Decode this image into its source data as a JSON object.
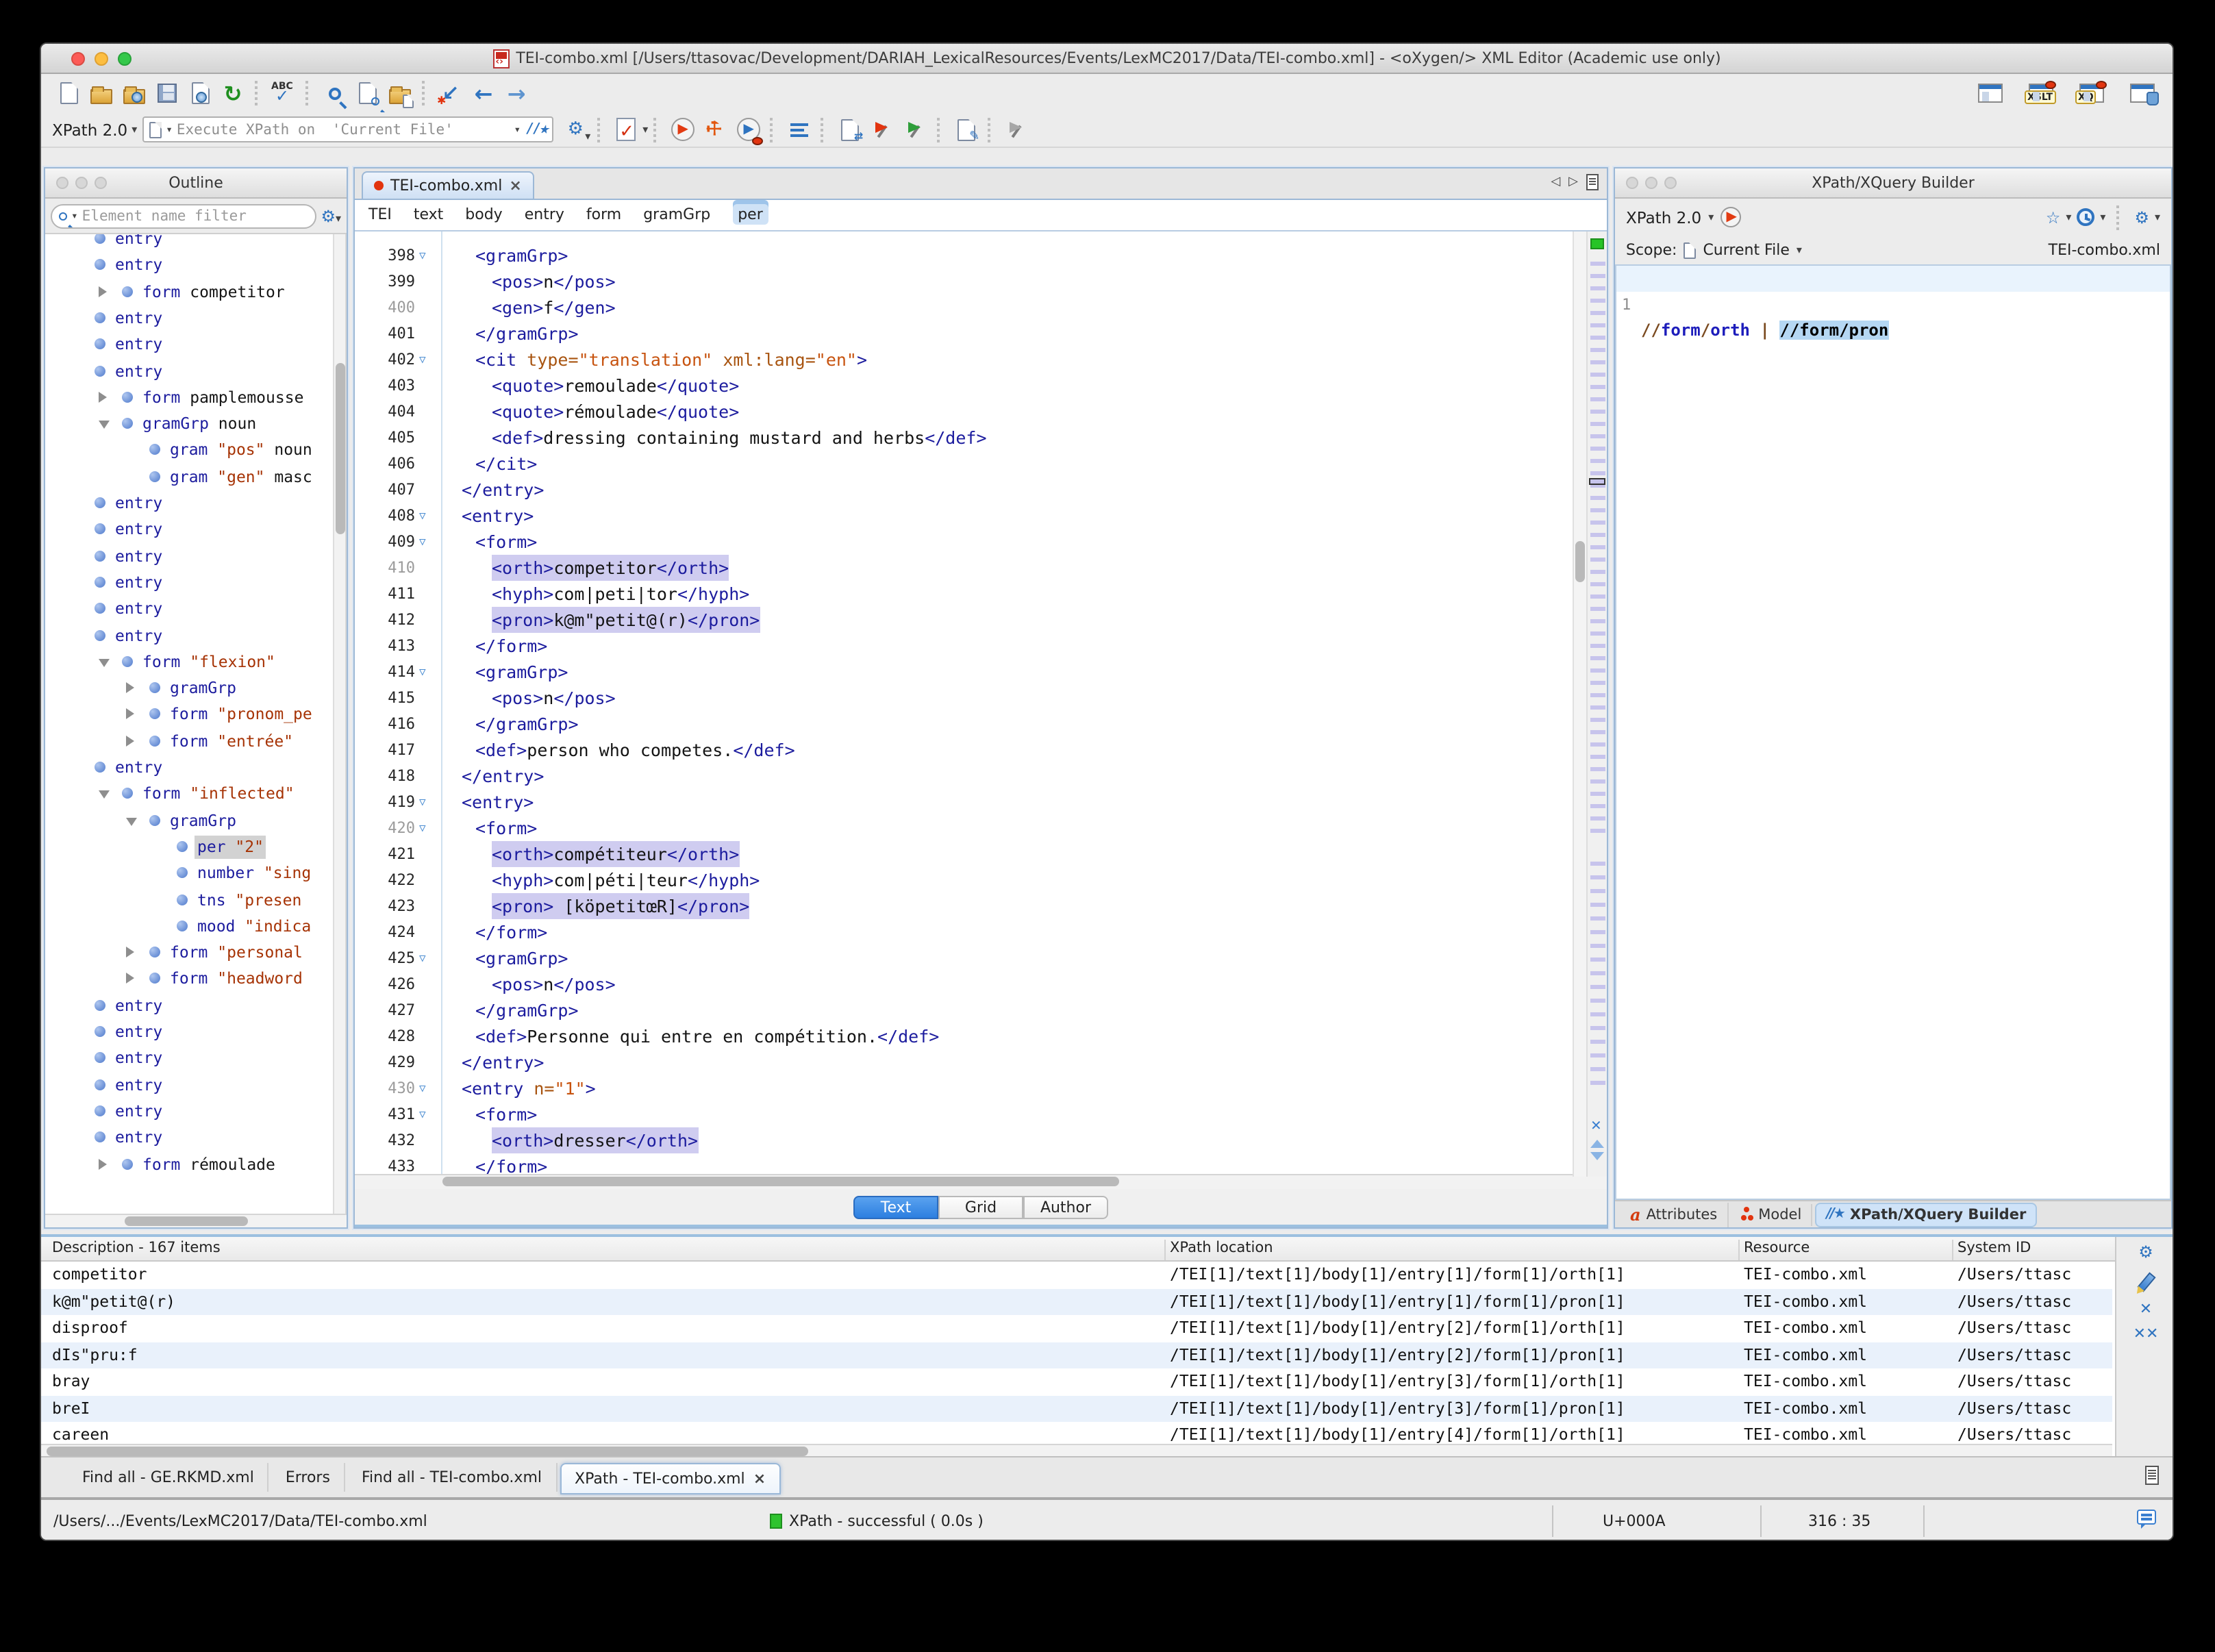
{
  "window": {
    "title": "TEI-combo.xml [/Users/ttasovac/Development/DARIAH_LexicalResources/Events/LexMC2017/Data/TEI-combo.xml] - <oXygen/> XML Editor (Academic use only)"
  },
  "toolbar": {
    "xpath_version": "XPath 2.0",
    "execute_label": "Execute XPath on",
    "execute_scope": "'Current File'"
  },
  "outline": {
    "title": "Outline",
    "filter_placeholder": "Element name filter",
    "items": [
      {
        "ind": 0,
        "arrow": "",
        "parts": [
          [
            "el",
            "entry"
          ]
        ],
        "clip": true
      },
      {
        "ind": 0,
        "arrow": "",
        "parts": [
          [
            "el",
            "entry"
          ]
        ]
      },
      {
        "ind": 1,
        "arrow": "r",
        "parts": [
          [
            "el",
            "form"
          ],
          [
            "tx",
            " competitor"
          ]
        ]
      },
      {
        "ind": 0,
        "arrow": "",
        "parts": [
          [
            "el",
            "entry"
          ]
        ]
      },
      {
        "ind": 0,
        "arrow": "",
        "parts": [
          [
            "el",
            "entry"
          ]
        ]
      },
      {
        "ind": 0,
        "arrow": "",
        "parts": [
          [
            "el",
            "entry"
          ]
        ]
      },
      {
        "ind": 1,
        "arrow": "r",
        "parts": [
          [
            "el",
            "form"
          ],
          [
            "tx",
            " pamplemousse"
          ]
        ]
      },
      {
        "ind": 1,
        "arrow": "d",
        "parts": [
          [
            "el",
            "gramGrp"
          ],
          [
            "tx",
            " noun"
          ]
        ]
      },
      {
        "ind": 2,
        "arrow": "",
        "parts": [
          [
            "el",
            "gram"
          ],
          [
            "q",
            " \"pos\""
          ],
          [
            "tx",
            " noun"
          ]
        ]
      },
      {
        "ind": 2,
        "arrow": "",
        "parts": [
          [
            "el",
            "gram"
          ],
          [
            "q",
            " \"gen\""
          ],
          [
            "tx",
            " masc"
          ]
        ]
      },
      {
        "ind": 0,
        "arrow": "",
        "parts": [
          [
            "el",
            "entry"
          ]
        ]
      },
      {
        "ind": 0,
        "arrow": "",
        "parts": [
          [
            "el",
            "entry"
          ]
        ]
      },
      {
        "ind": 0,
        "arrow": "",
        "parts": [
          [
            "el",
            "entry"
          ]
        ]
      },
      {
        "ind": 0,
        "arrow": "",
        "parts": [
          [
            "el",
            "entry"
          ]
        ]
      },
      {
        "ind": 0,
        "arrow": "",
        "parts": [
          [
            "el",
            "entry"
          ]
        ]
      },
      {
        "ind": 0,
        "arrow": "",
        "parts": [
          [
            "el",
            "entry"
          ]
        ]
      },
      {
        "ind": 1,
        "arrow": "d",
        "parts": [
          [
            "el",
            "form"
          ],
          [
            "q",
            " \"flexion\""
          ]
        ]
      },
      {
        "ind": 2,
        "arrow": "r",
        "parts": [
          [
            "el",
            "gramGrp"
          ]
        ]
      },
      {
        "ind": 2,
        "arrow": "r",
        "parts": [
          [
            "el",
            "form"
          ],
          [
            "q",
            " \"pronom_pe"
          ]
        ]
      },
      {
        "ind": 2,
        "arrow": "r",
        "parts": [
          [
            "el",
            "form"
          ],
          [
            "q",
            " \"entrée\""
          ]
        ]
      },
      {
        "ind": 0,
        "arrow": "",
        "parts": [
          [
            "el",
            "entry"
          ]
        ]
      },
      {
        "ind": 1,
        "arrow": "d",
        "parts": [
          [
            "el",
            "form"
          ],
          [
            "q",
            " \"inflected\""
          ]
        ]
      },
      {
        "ind": 2,
        "arrow": "d",
        "parts": [
          [
            "el",
            "gramGrp"
          ]
        ]
      },
      {
        "ind": 3,
        "arrow": "",
        "sel": true,
        "parts": [
          [
            "el",
            "per"
          ],
          [
            "q",
            " \"2\""
          ]
        ]
      },
      {
        "ind": 3,
        "arrow": "",
        "parts": [
          [
            "el",
            "number"
          ],
          [
            "q",
            " \"sing"
          ]
        ]
      },
      {
        "ind": 3,
        "arrow": "",
        "parts": [
          [
            "el",
            "tns"
          ],
          [
            "q",
            " \"presen"
          ]
        ]
      },
      {
        "ind": 3,
        "arrow": "",
        "parts": [
          [
            "el",
            "mood"
          ],
          [
            "q",
            " \"indica"
          ]
        ]
      },
      {
        "ind": 2,
        "arrow": "r",
        "parts": [
          [
            "el",
            "form"
          ],
          [
            "q",
            " \"personal"
          ]
        ]
      },
      {
        "ind": 2,
        "arrow": "r",
        "parts": [
          [
            "el",
            "form"
          ],
          [
            "q",
            " \"headword"
          ]
        ]
      },
      {
        "ind": 0,
        "arrow": "",
        "parts": [
          [
            "el",
            "entry"
          ]
        ]
      },
      {
        "ind": 0,
        "arrow": "",
        "parts": [
          [
            "el",
            "entry"
          ]
        ]
      },
      {
        "ind": 0,
        "arrow": "",
        "parts": [
          [
            "el",
            "entry"
          ]
        ]
      },
      {
        "ind": 0,
        "arrow": "",
        "parts": [
          [
            "el",
            "entry"
          ]
        ]
      },
      {
        "ind": 0,
        "arrow": "",
        "parts": [
          [
            "el",
            "entry"
          ]
        ]
      },
      {
        "ind": 0,
        "arrow": "",
        "parts": [
          [
            "el",
            "entry"
          ]
        ]
      },
      {
        "ind": 1,
        "arrow": "r",
        "parts": [
          [
            "el",
            "form"
          ],
          [
            "tx",
            " rémoulade"
          ]
        ]
      }
    ]
  },
  "editor": {
    "tab": "TEI-combo.xml",
    "breadcrumb": [
      "TEI",
      "text",
      "body",
      "entry",
      "form",
      "gramGrp",
      "per"
    ],
    "views": [
      "Text",
      "Grid",
      "Author"
    ],
    "active_view": "Text",
    "lines": [
      {
        "n": 398,
        "i": 1,
        "f": 1,
        "g": 0,
        "h": 0,
        "s": [
          [
            "t",
            "<gramGrp>"
          ]
        ]
      },
      {
        "n": 399,
        "i": 2,
        "f": 0,
        "g": 0,
        "h": 0,
        "s": [
          [
            "t",
            "<pos>"
          ],
          [
            "x",
            "n"
          ],
          [
            "t",
            "</pos>"
          ]
        ]
      },
      {
        "n": 400,
        "i": 2,
        "f": 0,
        "g": 1,
        "h": 0,
        "s": [
          [
            "t",
            "<gen>"
          ],
          [
            "x",
            "f"
          ],
          [
            "t",
            "</gen>"
          ]
        ]
      },
      {
        "n": 401,
        "i": 1,
        "f": 0,
        "g": 0,
        "h": 0,
        "s": [
          [
            "t",
            "</gramGrp>"
          ]
        ]
      },
      {
        "n": 402,
        "i": 1,
        "f": 1,
        "g": 0,
        "h": 0,
        "s": [
          [
            "t",
            "<cit "
          ],
          [
            "a",
            "type="
          ],
          [
            "v",
            "\"translation\""
          ],
          [
            "x",
            " "
          ],
          [
            "a",
            "xml:lang="
          ],
          [
            "v",
            "\"en\""
          ],
          [
            "t",
            ">"
          ]
        ]
      },
      {
        "n": 403,
        "i": 2,
        "f": 0,
        "g": 0,
        "h": 0,
        "s": [
          [
            "t",
            "<quote>"
          ],
          [
            "x",
            "remoulade"
          ],
          [
            "t",
            "</quote>"
          ]
        ]
      },
      {
        "n": 404,
        "i": 2,
        "f": 0,
        "g": 0,
        "h": 0,
        "s": [
          [
            "t",
            "<quote>"
          ],
          [
            "x",
            "rémoulade"
          ],
          [
            "t",
            "</quote>"
          ]
        ]
      },
      {
        "n": 405,
        "i": 2,
        "f": 0,
        "g": 0,
        "h": 0,
        "s": [
          [
            "t",
            "<def>"
          ],
          [
            "x",
            "dressing containing mustard and herbs"
          ],
          [
            "t",
            "</def>"
          ]
        ]
      },
      {
        "n": 406,
        "i": 1,
        "f": 0,
        "g": 0,
        "h": 0,
        "s": [
          [
            "t",
            "</cit>"
          ]
        ]
      },
      {
        "n": 407,
        "i": 0,
        "f": 0,
        "g": 0,
        "h": 0,
        "s": [
          [
            "t",
            "</entry>"
          ]
        ]
      },
      {
        "n": 408,
        "i": 0,
        "f": 1,
        "g": 0,
        "h": 0,
        "s": [
          [
            "t",
            "<entry>"
          ]
        ]
      },
      {
        "n": 409,
        "i": 1,
        "f": 1,
        "g": 0,
        "h": 0,
        "s": [
          [
            "t",
            "<form>"
          ]
        ]
      },
      {
        "n": 410,
        "i": 2,
        "f": 0,
        "g": 1,
        "h": 1,
        "s": [
          [
            "t",
            "<orth>"
          ],
          [
            "x",
            "competitor"
          ],
          [
            "t",
            "</orth>"
          ]
        ]
      },
      {
        "n": 411,
        "i": 2,
        "f": 0,
        "g": 0,
        "h": 0,
        "s": [
          [
            "t",
            "<hyph>"
          ],
          [
            "x",
            "com|peti|tor"
          ],
          [
            "t",
            "</hyph>"
          ]
        ]
      },
      {
        "n": 412,
        "i": 2,
        "f": 0,
        "g": 0,
        "h": 1,
        "s": [
          [
            "t",
            "<pron>"
          ],
          [
            "x",
            "k@m\"petit@(r)"
          ],
          [
            "t",
            "</pron>"
          ]
        ]
      },
      {
        "n": 413,
        "i": 1,
        "f": 0,
        "g": 0,
        "h": 0,
        "s": [
          [
            "t",
            "</form>"
          ]
        ]
      },
      {
        "n": 414,
        "i": 1,
        "f": 1,
        "g": 0,
        "h": 0,
        "s": [
          [
            "t",
            "<gramGrp>"
          ]
        ]
      },
      {
        "n": 415,
        "i": 2,
        "f": 0,
        "g": 0,
        "h": 0,
        "s": [
          [
            "t",
            "<pos>"
          ],
          [
            "x",
            "n"
          ],
          [
            "t",
            "</pos>"
          ]
        ]
      },
      {
        "n": 416,
        "i": 1,
        "f": 0,
        "g": 0,
        "h": 0,
        "s": [
          [
            "t",
            "</gramGrp>"
          ]
        ]
      },
      {
        "n": 417,
        "i": 1,
        "f": 0,
        "g": 0,
        "h": 0,
        "s": [
          [
            "t",
            "<def>"
          ],
          [
            "x",
            "person who competes."
          ],
          [
            "t",
            "</def>"
          ]
        ]
      },
      {
        "n": 418,
        "i": 0,
        "f": 0,
        "g": 0,
        "h": 0,
        "s": [
          [
            "t",
            "</entry>"
          ]
        ]
      },
      {
        "n": 419,
        "i": 0,
        "f": 1,
        "g": 0,
        "h": 0,
        "s": [
          [
            "t",
            "<entry>"
          ]
        ]
      },
      {
        "n": 420,
        "i": 1,
        "f": 1,
        "g": 1,
        "h": 0,
        "s": [
          [
            "t",
            "<form>"
          ]
        ]
      },
      {
        "n": 421,
        "i": 2,
        "f": 0,
        "g": 0,
        "h": 1,
        "s": [
          [
            "t",
            "<orth>"
          ],
          [
            "x",
            "compétiteur"
          ],
          [
            "t",
            "</orth>"
          ]
        ]
      },
      {
        "n": 422,
        "i": 2,
        "f": 0,
        "g": 0,
        "h": 0,
        "s": [
          [
            "t",
            "<hyph>"
          ],
          [
            "x",
            "com|péti|teur"
          ],
          [
            "t",
            "</hyph>"
          ]
        ]
      },
      {
        "n": 423,
        "i": 2,
        "f": 0,
        "g": 0,
        "h": 1,
        "s": [
          [
            "t",
            "<pron>"
          ],
          [
            "x",
            " [köpetitœR]"
          ],
          [
            "t",
            "</pron>"
          ]
        ]
      },
      {
        "n": 424,
        "i": 1,
        "f": 0,
        "g": 0,
        "h": 0,
        "s": [
          [
            "t",
            "</form>"
          ]
        ]
      },
      {
        "n": 425,
        "i": 1,
        "f": 1,
        "g": 0,
        "h": 0,
        "s": [
          [
            "t",
            "<gramGrp>"
          ]
        ]
      },
      {
        "n": 426,
        "i": 2,
        "f": 0,
        "g": 0,
        "h": 0,
        "s": [
          [
            "t",
            "<pos>"
          ],
          [
            "x",
            "n"
          ],
          [
            "t",
            "</pos>"
          ]
        ]
      },
      {
        "n": 427,
        "i": 1,
        "f": 0,
        "g": 0,
        "h": 0,
        "s": [
          [
            "t",
            "</gramGrp>"
          ]
        ]
      },
      {
        "n": 428,
        "i": 1,
        "f": 0,
        "g": 0,
        "h": 0,
        "s": [
          [
            "t",
            "<def>"
          ],
          [
            "x",
            "Personne qui entre en compétition."
          ],
          [
            "t",
            "</def>"
          ]
        ]
      },
      {
        "n": 429,
        "i": 0,
        "f": 0,
        "g": 0,
        "h": 0,
        "s": [
          [
            "t",
            "</entry>"
          ]
        ]
      },
      {
        "n": 430,
        "i": 0,
        "f": 1,
        "g": 1,
        "h": 0,
        "s": [
          [
            "t",
            "<entry "
          ],
          [
            "a",
            "n="
          ],
          [
            "v",
            "\"1\""
          ],
          [
            "t",
            ">"
          ]
        ]
      },
      {
        "n": 431,
        "i": 1,
        "f": 1,
        "g": 0,
        "h": 0,
        "s": [
          [
            "t",
            "<form>"
          ]
        ]
      },
      {
        "n": 432,
        "i": 2,
        "f": 0,
        "g": 0,
        "h": 1,
        "s": [
          [
            "t",
            "<orth>"
          ],
          [
            "x",
            "dresser"
          ],
          [
            "t",
            "</orth>"
          ]
        ]
      },
      {
        "n": 433,
        "i": 1,
        "f": 0,
        "g": 0,
        "h": 0,
        "s": [
          [
            "t",
            "</form>"
          ]
        ]
      }
    ]
  },
  "xpath_panel": {
    "title": "XPath/XQuery Builder",
    "version": "XPath 2.0",
    "scope_label": "Scope:",
    "scope_value": "Current File",
    "resource": "TEI-combo.xml",
    "line_no": "1",
    "expr": [
      [
        "op",
        "//"
      ],
      [
        "name",
        "form"
      ],
      [
        "op",
        "/"
      ],
      [
        "name",
        "orth"
      ],
      [
        "op",
        " | "
      ],
      [
        "sel",
        "//form/pron"
      ]
    ],
    "tabs": [
      "Attributes",
      "Model",
      "XPath/XQuery Builder"
    ],
    "active_tab": "XPath/XQuery Builder"
  },
  "results": {
    "header_description": "Description - 167 items",
    "header_xpath": "XPath location",
    "header_resource": "Resource",
    "header_system": "System ID",
    "rows": [
      {
        "d": "competitor",
        "x": "/TEI[1]/text[1]/body[1]/entry[1]/form[1]/orth[1]",
        "r": "TEI-combo.xml",
        "s": "/Users/ttasc"
      },
      {
        "d": "k@m\"petit@(r)",
        "x": "/TEI[1]/text[1]/body[1]/entry[1]/form[1]/pron[1]",
        "r": "TEI-combo.xml",
        "s": "/Users/ttasc"
      },
      {
        "d": "disproof",
        "x": "/TEI[1]/text[1]/body[1]/entry[2]/form[1]/orth[1]",
        "r": "TEI-combo.xml",
        "s": "/Users/ttasc"
      },
      {
        "d": "dIs\"pru:f",
        "x": "/TEI[1]/text[1]/body[1]/entry[2]/form[1]/pron[1]",
        "r": "TEI-combo.xml",
        "s": "/Users/ttasc"
      },
      {
        "d": "bray",
        "x": "/TEI[1]/text[1]/body[1]/entry[3]/form[1]/orth[1]",
        "r": "TEI-combo.xml",
        "s": "/Users/ttasc"
      },
      {
        "d": "breI",
        "x": "/TEI[1]/text[1]/body[1]/entry[3]/form[1]/pron[1]",
        "r": "TEI-combo.xml",
        "s": "/Users/ttasc"
      },
      {
        "d": "careen",
        "x": "/TEI[1]/text[1]/body[1]/entry[4]/form[1]/orth[1]",
        "r": "TEI-combo.xml",
        "s": "/Users/ttasc"
      }
    ]
  },
  "bottom_tabs": [
    "Find all - GE.RKMD.xml",
    "Errors",
    "Find all - TEI-combo.xml",
    "XPath - TEI-combo.xml"
  ],
  "bottom_active_tab": "XPath - TEI-combo.xml",
  "statusbar": {
    "path": "/Users/.../Events/LexMC2017/Data/TEI-combo.xml",
    "status": "XPath - successful ( 0.0s )",
    "encoding": "U+000A",
    "position": "316 : 35"
  },
  "colors": {
    "tag": "#1c1c9e",
    "attr_name": "#a85410",
    "attr_value": "#c7530f",
    "highlight": "#cfccf0",
    "selection": "#b5d7f3",
    "status_green": "#2fc32f",
    "accent_blue": "#2f74c0"
  },
  "icons": [
    "new-document",
    "open-folder",
    "open-url",
    "save",
    "save-remote",
    "reload",
    "spell-check",
    "search",
    "find-replace",
    "find-in-files",
    "back-to-modification",
    "back",
    "forward",
    "layout",
    "xslt-debugger",
    "xquery-debugger",
    "database-explorer",
    "gear",
    "validate",
    "apply-transformation",
    "configure-transformation",
    "debug",
    "outline-list",
    "format-indent",
    "red-pin",
    "green-pin",
    "edit",
    "gray-pin",
    "favorites-star",
    "history-clock",
    "scope-document",
    "attributes-a",
    "model-dots",
    "builder-star",
    "highlight-pencil",
    "remove-x",
    "remove-all-x",
    "message-bubble",
    "scroll-list"
  ]
}
